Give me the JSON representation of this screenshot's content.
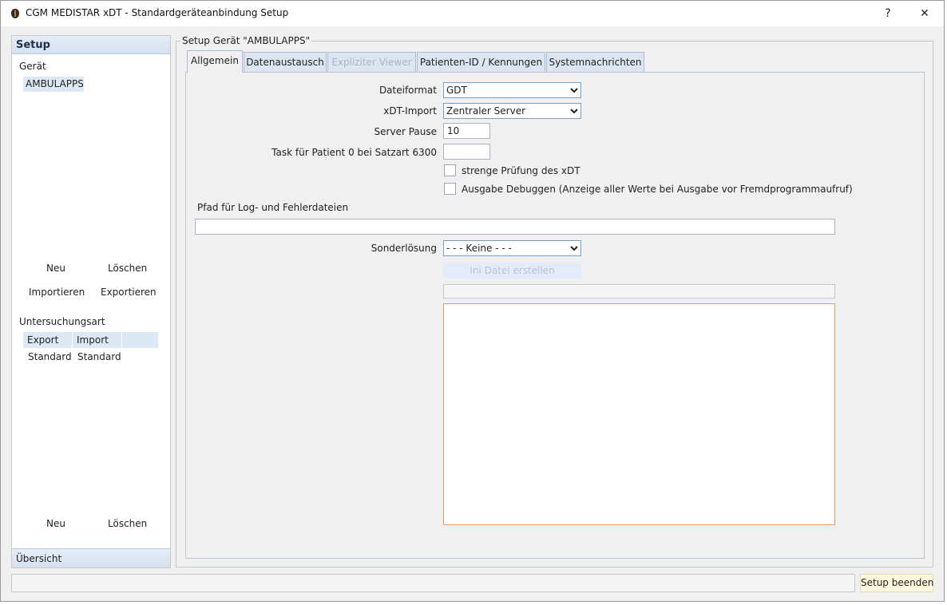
{
  "window": {
    "title": "CGM MEDISTAR xDT - Standardgeräteanbindung  Setup",
    "help_label": "?",
    "close_label": "✕"
  },
  "left_panel": {
    "header": "Setup",
    "device_section_label": "Gerät",
    "devices": [
      "AMBULAPPS"
    ],
    "new_label": "Neu",
    "delete_label": "Löschen",
    "import_label": "Importieren",
    "export_label": "Exportieren",
    "exam_type_label": "Untersuchungsart",
    "exam_columns": [
      "Export",
      "Import"
    ],
    "exam_rows": [
      [
        "Standard",
        "Standard"
      ]
    ],
    "new_label_2": "Neu",
    "delete_label_2": "Löschen",
    "footer": "Übersicht"
  },
  "main": {
    "group_title": "Setup Gerät \"AMBULAPPS\"",
    "tabs": [
      {
        "label": "Allgemein",
        "active": true,
        "enabled": true
      },
      {
        "label": "Datenaustausch",
        "active": false,
        "enabled": true
      },
      {
        "label": "Expliziter Viewer",
        "active": false,
        "enabled": false
      },
      {
        "label": "Patienten-ID / Kennungen",
        "active": false,
        "enabled": true
      },
      {
        "label": "Systemnachrichten",
        "active": false,
        "enabled": true
      }
    ],
    "form": {
      "file_format_label": "Dateiformat",
      "file_format_value": "GDT",
      "xdt_import_label": "xDT-Import",
      "xdt_import_value": "Zentraler Server",
      "server_pause_label": "Server Pause",
      "server_pause_value": "10",
      "task_label": "Task für Patient 0 bei Satzart 6300",
      "task_value": "",
      "strict_check_label": "strenge Prüfung des xDT",
      "strict_check_checked": false,
      "debug_output_label": "Ausgabe Debuggen (Anzeige aller Werte bei Ausgabe vor Fremdprogrammaufruf)",
      "debug_output_checked": false,
      "log_path_label": "Pfad für Log- und Fehlerdateien",
      "log_path_value": "",
      "special_solution_label": "Sonderlösung",
      "special_solution_value": "- - - Keine - - -",
      "create_ini_label": "Ini Datei erstellen"
    }
  },
  "status_bar": {
    "text": "",
    "finish_label": "Setup beenden"
  },
  "colors": {
    "header_bg": "#dde8f5",
    "memo_border": "#e0a060",
    "finish_bg": "#fff8dc"
  }
}
